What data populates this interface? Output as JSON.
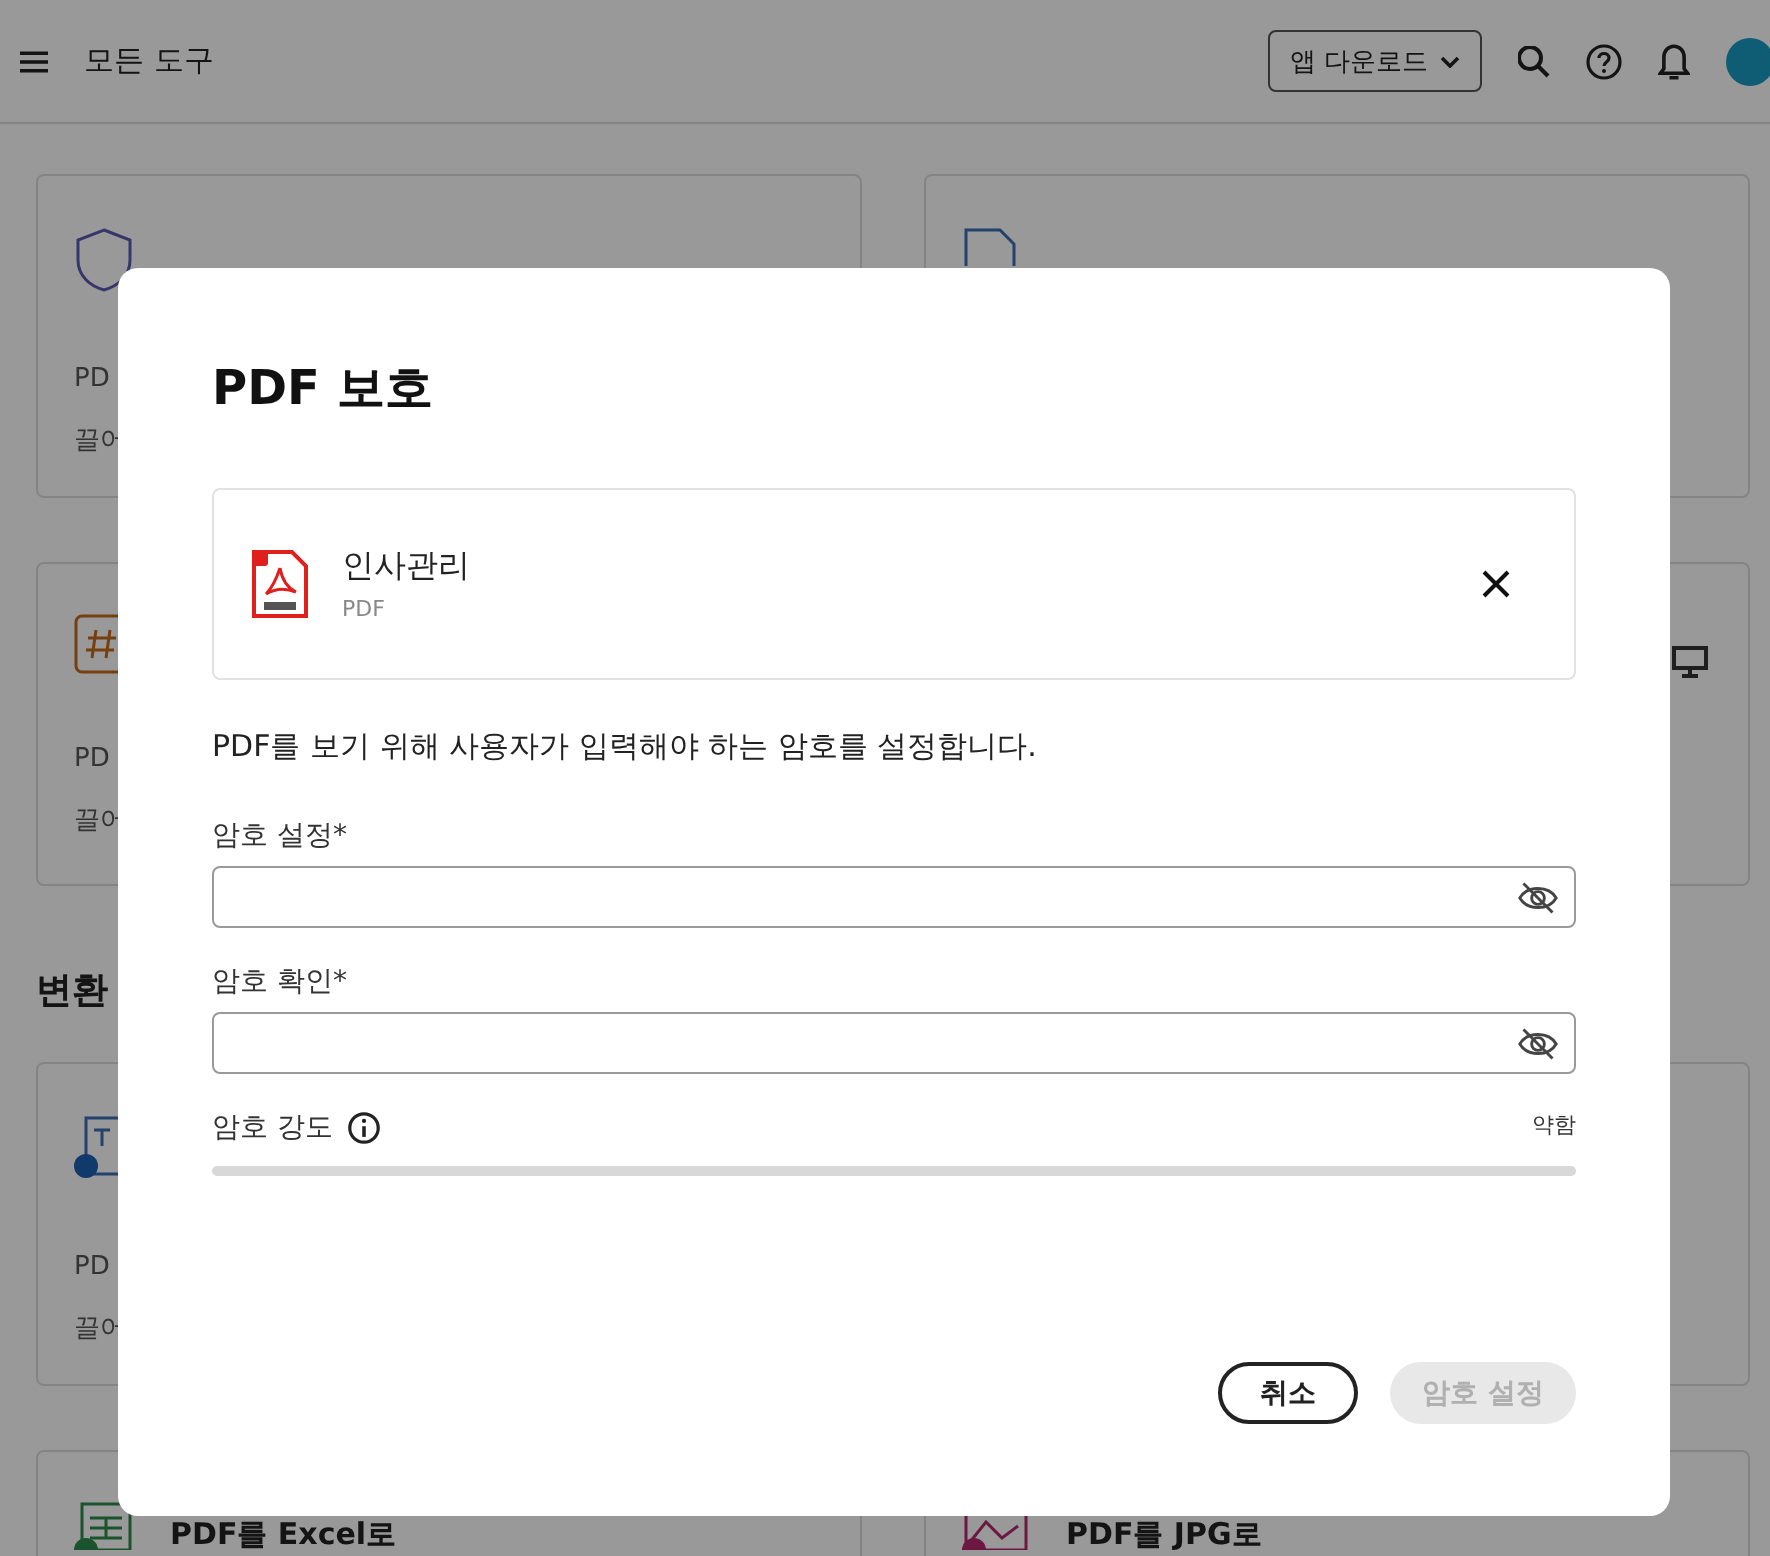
{
  "header": {
    "title": "모든 도구",
    "download_button": "앱 다운로드"
  },
  "tool_cards": [
    {
      "kind": "shield",
      "line_1": "PD",
      "line_2": "끌어"
    },
    {
      "kind": "page"
    },
    {
      "kind": "hash",
      "line_1": "PD",
      "line_2": "끌어"
    },
    {
      "kind": "monitor"
    }
  ],
  "section_title": "변환",
  "convert_cards": [
    {
      "kind": "text",
      "line_1": "PD",
      "line_2": "끌어"
    },
    {
      "kind": "blank"
    },
    {
      "kind": "sheet",
      "title": "PDF를 Excel로"
    },
    {
      "kind": "image",
      "title": "PDF를 JPG로"
    }
  ],
  "dialog": {
    "title": "PDF 보호",
    "file": {
      "name": "인사관리",
      "type": "PDF"
    },
    "description": "PDF를 보기 위해 사용자가 입력해야 하는 암호를 설정합니다.",
    "fields": [
      {
        "label": "암호 설정*"
      },
      {
        "label": "암호 확인*"
      }
    ],
    "strength": {
      "label": "암호 강도",
      "reading": "약함"
    },
    "buttons": [
      {
        "label": "취소",
        "disabled": false
      },
      {
        "label": "암호 설정",
        "disabled": true
      }
    ]
  }
}
